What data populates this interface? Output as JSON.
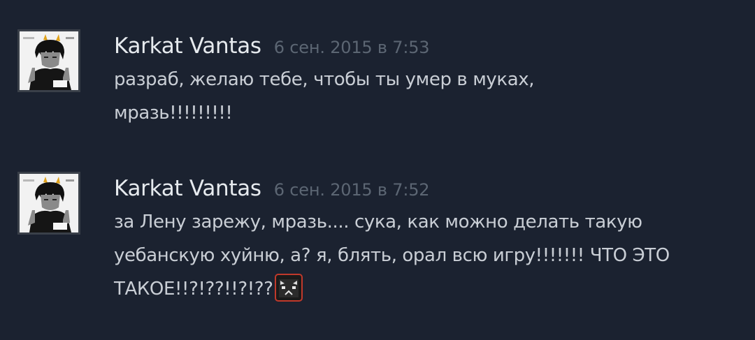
{
  "comments": [
    {
      "author": "Karkat Vantas",
      "timestamp": "6 сен. 2015 в 7:53",
      "text": "разраб, желаю тебе, чтобы ты умер в муках, мразь!!!!!!!!!",
      "avatar_icon": "user-avatar-icon"
    },
    {
      "author": "Karkat Vantas",
      "timestamp": "6 сен. 2015 в 7:52",
      "text": "за Лену зарежу, мразь.... сука, как можно делать такую уебанскую хуйню, а? я, блять, орал всю игру!!!!!!! ЧТО ЭТО ТАКОЕ!!?!??!!?!??",
      "avatar_icon": "user-avatar-icon",
      "emoticon": "angry-face-emoticon"
    }
  ],
  "colors": {
    "background": "#1b2230",
    "author": "#e6eaee",
    "timestamp": "#5c6673",
    "text": "#c9ced5",
    "avatar_frame": "#3a4049",
    "emoticon_border": "#c0392b"
  }
}
